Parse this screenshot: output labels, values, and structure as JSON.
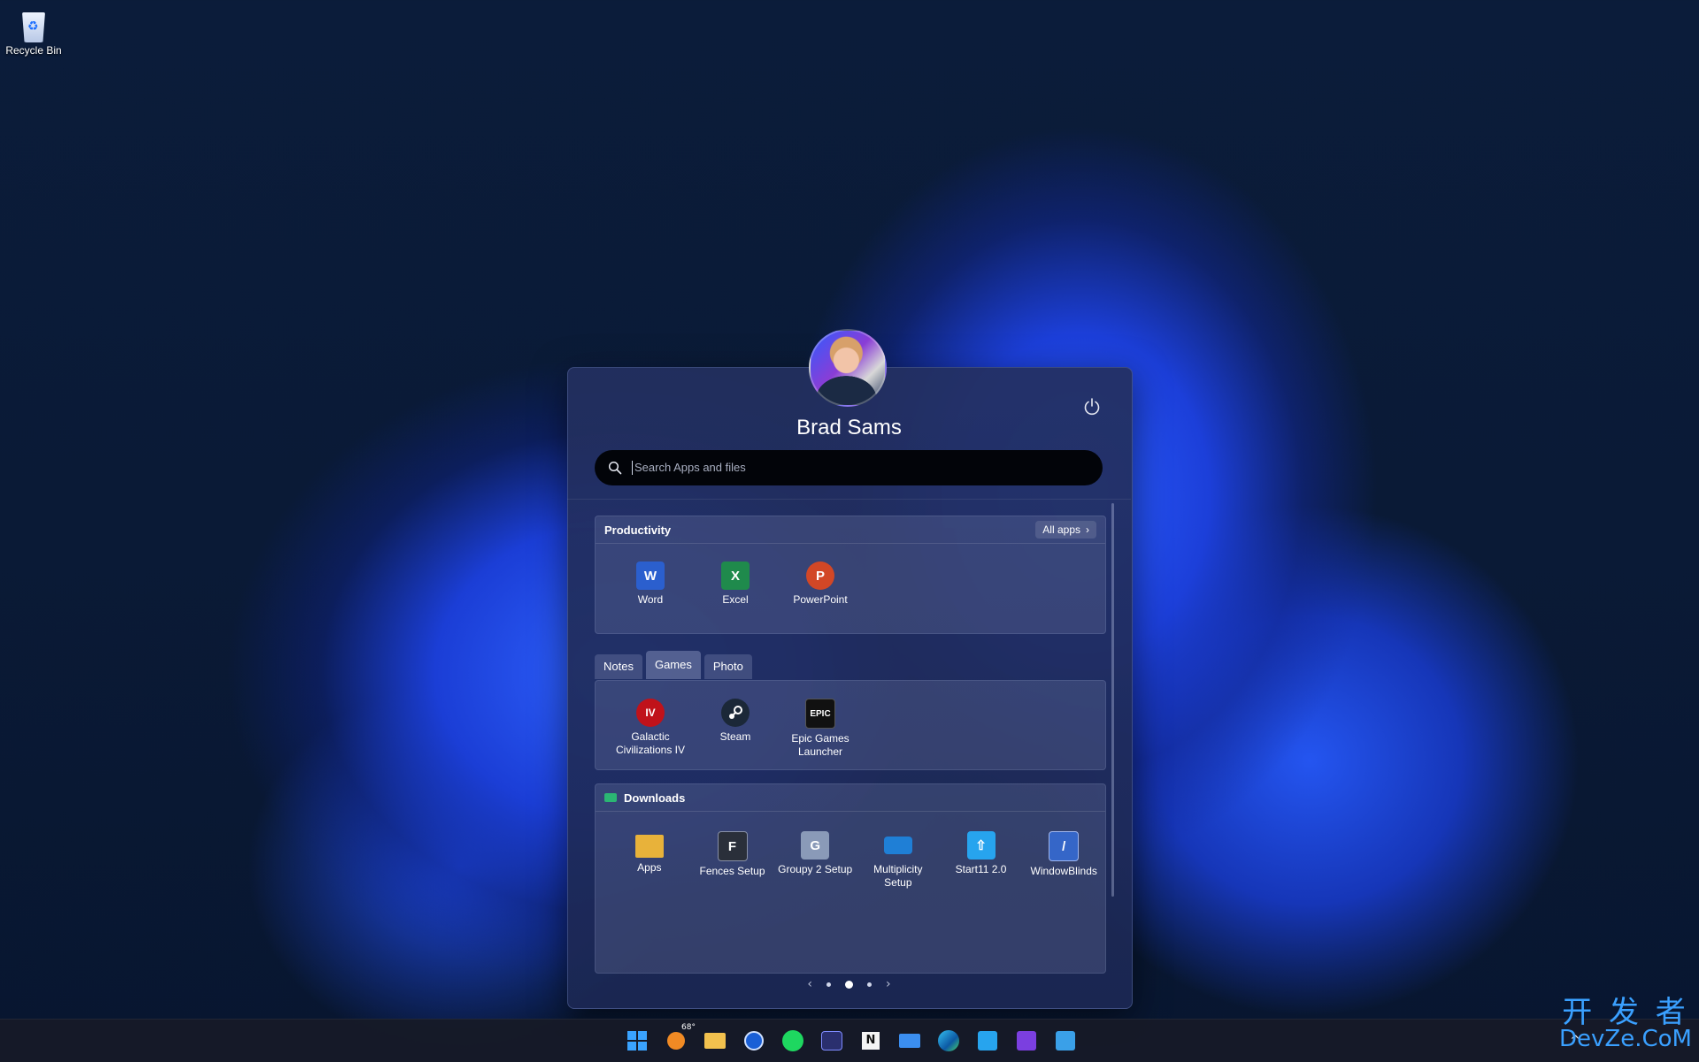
{
  "desktop": {
    "recycle_bin_label": "Recycle Bin"
  },
  "start_menu": {
    "user_name": "Brad Sams",
    "search_placeholder": "Search Apps and files",
    "productivity": {
      "title": "Productivity",
      "all_apps_label": "All apps",
      "apps": [
        {
          "label": "Word",
          "icon": "word-icon",
          "color": "#2b5fce",
          "glyph": "W"
        },
        {
          "label": "Excel",
          "icon": "excel-icon",
          "color": "#1f8a4c",
          "glyph": "X"
        },
        {
          "label": "PowerPoint",
          "icon": "powerpoint-icon",
          "color": "#d24726",
          "glyph": "P"
        }
      ]
    },
    "tabs": [
      {
        "label": "Notes",
        "active": false
      },
      {
        "label": "Games",
        "active": true
      },
      {
        "label": "Photo",
        "active": false
      }
    ],
    "games": {
      "apps": [
        {
          "label1": "Galactic",
          "label2": "Civilizations IV",
          "icon": "galactic-civilizations-icon",
          "color": "#c0121a",
          "glyph": "IV"
        },
        {
          "label1": "Steam",
          "label2": "",
          "icon": "steam-icon",
          "color": "#1b2838",
          "glyph": "S"
        },
        {
          "label1": "Epic Games",
          "label2": "Launcher",
          "icon": "epic-games-icon",
          "color": "#111111",
          "glyph": "EPIC"
        }
      ]
    },
    "downloads": {
      "title": "Downloads",
      "apps": [
        {
          "label1": "Apps",
          "label2": "",
          "icon": "folder-icon",
          "color": "#e8b23a"
        },
        {
          "label1": "Fences Setup",
          "label2": "",
          "icon": "fences-icon",
          "color": "#2a2f3a"
        },
        {
          "label1": "Groupy 2 Setup",
          "label2": "",
          "icon": "groupy-icon",
          "color": "#8a9ab8"
        },
        {
          "label1": "Multiplicity",
          "label2": "Setup",
          "icon": "multiplicity-icon",
          "color": "#1f7fd6"
        },
        {
          "label1": "Start11 2.0",
          "label2": "",
          "icon": "start11-icon",
          "color": "#27a4ee"
        },
        {
          "label1": "WindowBlinds",
          "label2": "",
          "icon": "windowblinds-icon",
          "color": "#3566c8"
        }
      ]
    }
  },
  "taskbar": {
    "weather_temp": "68°",
    "icons": [
      "start-icon",
      "weather-icon",
      "file-explorer-icon",
      "1password-icon",
      "spotify-icon",
      "app-icon",
      "notion-icon",
      "mail-icon",
      "edge-icon",
      "start11-icon",
      "affinity-icon",
      "paint-icon"
    ]
  },
  "watermark": {
    "chinese": "开 发 者",
    "latin": "DevZe.CoM"
  }
}
